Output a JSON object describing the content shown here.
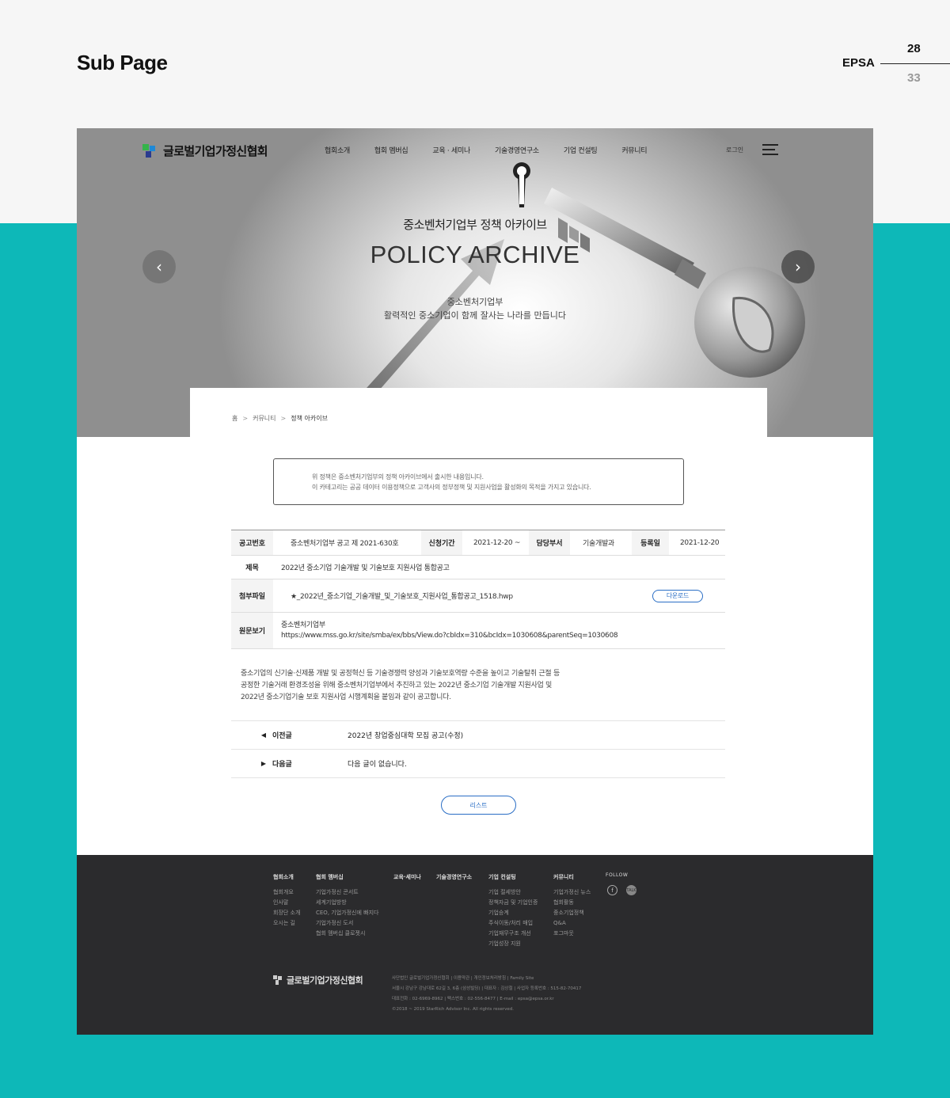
{
  "header": {
    "title": "Sub Page",
    "brand": "EPSA",
    "page_current": "28",
    "page_total": "33"
  },
  "site": {
    "logo": "글로벌기업가정신협회",
    "nav": [
      "협회소개",
      "협회 멤버십",
      "교육 · 세미나",
      "기술경영연구소",
      "기업 컨설팅",
      "커뮤니티"
    ],
    "login": "로그인"
  },
  "hero": {
    "kor_title": "중소벤처기업부 정책 아카이브",
    "eng_title": "POLICY ARCHIVE",
    "sub1": "중소벤처기업부",
    "sub2": "활력적인 중소기업이 함께 잘사는 나라를 만듭니다",
    "prev": "‹",
    "next": "›"
  },
  "breadcrumb": {
    "home": "홈",
    "sep": ">",
    "level1": "커뮤니티",
    "level2": "정책 아카이브"
  },
  "notice": {
    "line1": "위 정책은 중소벤처기업부의 정책 아카이브에서 출시한 내용입니다.",
    "line2": "이 카테고리는 공공 데이터 이용정책으로 고객사의 정부정책 및 지원사업을 활성화의 목적을 가지고 있습니다."
  },
  "detail": {
    "notice_no_label": "공고번호",
    "notice_no": "중소벤처기업부 공고 제 2021-630호",
    "period_label": "신청기간",
    "period": "2021-12-20 ~",
    "dept_label": "담당부서",
    "dept": "기술개발과",
    "reg_label": "등록일",
    "reg": "2021-12-20",
    "title_label": "제목",
    "title": "2022년 중소기업 기술개발 및 기술보호 지원사업 통합공고",
    "file_label": "첨부파일",
    "file": "★_2022년_중소기업_기술개발_및_기술보호_지원사업_통합공고_1518.hwp",
    "download": "다운로드",
    "origin_label": "원문보기",
    "origin_org": "중소벤처기업부",
    "origin_url": "https://www.mss.go.kr/site/smba/ex/bbs/View.do?cbIdx=310&bcIdx=1030608&parentSeq=1030608"
  },
  "body": {
    "line1": "중소기업의 신기술·신제품 개발 및 공정혁신 등 기술경쟁력 양성과 기술보호역량 수준을 높이고 기술탈취 근절 등",
    "line2": "공정한 기술거래 환경조성을 위해 중소벤처기업부에서 추진하고 있는 2022년 중소기업 기술개발 지원사업 및",
    "line3": "2022년 중소기업기술 보호 지원사업 시행계획을 붙임과 같이 공고합니다."
  },
  "post_nav": {
    "prev_arrow": "◀",
    "prev_label": "이전글",
    "prev_title": "2022년 창업중심대학 모집 공고(수정)",
    "next_arrow": "▶",
    "next_label": "다음글",
    "next_title": "다음 글이 없습니다."
  },
  "list_button": "리스트",
  "footer": {
    "col1": {
      "h": "협회소개",
      "items": [
        "협회개요",
        "인사말",
        "회장단 소개",
        "오시는 길"
      ]
    },
    "col2": {
      "h": "협회 멤버십",
      "items": [
        "기업가정신 콘서트",
        "세계기업방방",
        "CEO, 기업가정신에 빠지다",
        "기업가정신 도서",
        "협회 멤버십 클로젯시"
      ]
    },
    "col3": {
      "h": "교육·세미나",
      "items": []
    },
    "col4": {
      "h": "기술경영연구소",
      "items": []
    },
    "col5": {
      "h": "기업 컨설팅",
      "items": [
        "기업 절세방안",
        "정책자금 및 기업인증",
        "기업승계",
        "주식이동/처리 매입",
        "기업재무구조 개선",
        "기업성장 지원"
      ]
    },
    "col6": {
      "h": "커뮤니티",
      "items": [
        "기업가정신 뉴스",
        "협회활동",
        "중소기업정책",
        "Q&A",
        "포그마웃"
      ]
    },
    "follow": "FOLLOW",
    "fb": "f",
    "talk": "TALK",
    "logo": "글로벌기업가정신협회",
    "info1": "사단법인 글로벌기업가정신협회 | 이용약관 | 개인정보처리방침 | Family Site",
    "info2": "서울시 강남구 강남대로 62길 3, 6층 (삼성빌딩) | 대표자 : 김상철 | 사업자 등록번호 : 515-82-70417",
    "info3": "대표전화 : 02-6969-8962 | 팩스번호 : 02-556-8477 | E-mail : epsa@epsa.or.kr",
    "info4": "©2018 ~ 2019 StarRich Advisor Inc. All rights reserved."
  }
}
